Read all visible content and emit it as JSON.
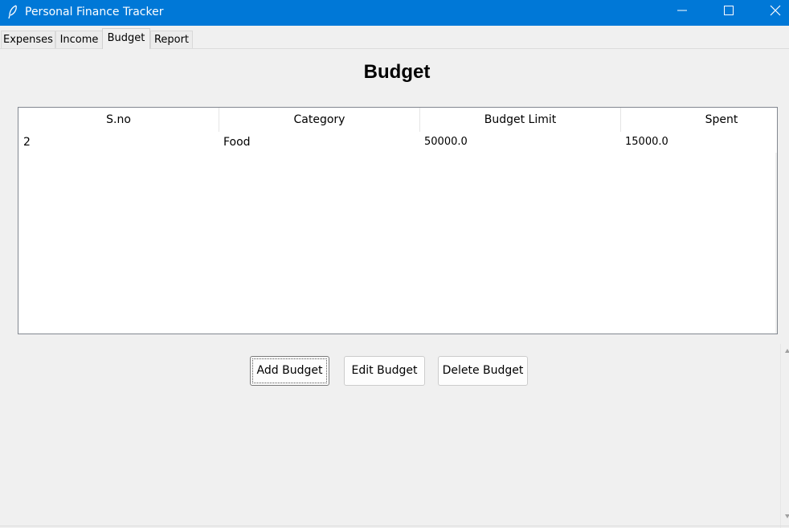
{
  "window": {
    "title": "Personal Finance Tracker",
    "app_icon": "feather-icon",
    "accent_color": "#0078d7",
    "controls": [
      "minimize-icon",
      "maximize-icon",
      "close-icon"
    ]
  },
  "tabs": [
    {
      "label": "Expenses",
      "active": false
    },
    {
      "label": "Income",
      "active": false
    },
    {
      "label": "Budget",
      "active": true
    },
    {
      "label": "Report",
      "active": false
    }
  ],
  "main": {
    "heading": "Budget",
    "table": {
      "columns": [
        "S.no",
        "Category",
        "Budget Limit",
        "Spent"
      ],
      "rows": [
        [
          "2",
          "Food",
          "50000.0",
          "15000.0"
        ]
      ]
    },
    "buttons": {
      "add": "Add Budget",
      "edit": "Edit Budget",
      "delete": "Delete Budget"
    }
  }
}
